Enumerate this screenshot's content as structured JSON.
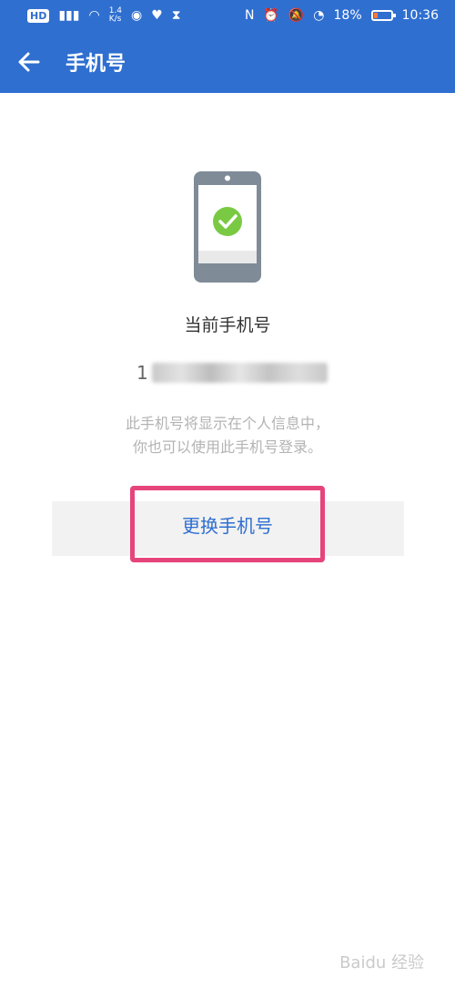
{
  "status_bar": {
    "hd_badge": "HD",
    "network_speed_value": "1.4",
    "network_speed_unit": "K/s",
    "battery_percent": "18%",
    "time": "10:36"
  },
  "header": {
    "title": "手机号"
  },
  "main": {
    "current_label": "当前手机号",
    "masked_number_first_digit": "1",
    "description_line1": "此手机号将显示在个人信息中，",
    "description_line2": "你也可以使用此手机号登录。",
    "change_button_label": "更换手机号"
  },
  "watermark": {
    "text": "Baidu 经验"
  },
  "colors": {
    "header_bg": "#2f6fd0",
    "link_blue": "#2f6fd0",
    "highlight_pink": "#e5457a",
    "check_green": "#7ac943"
  }
}
